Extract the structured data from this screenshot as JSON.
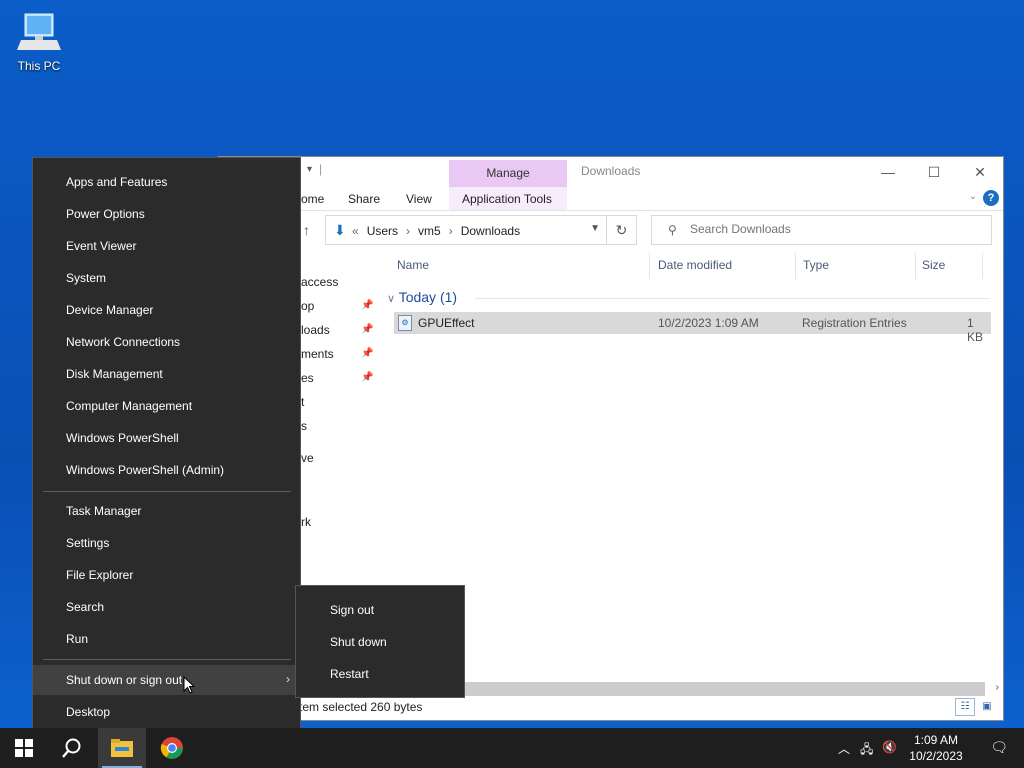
{
  "desktop": {
    "icons": [
      {
        "label": "This PC",
        "icon": "computer-icon"
      }
    ]
  },
  "explorer": {
    "title": "Downloads",
    "manage_tab": "Manage",
    "ribbon_tabs": {
      "home": "ome",
      "share": "Share",
      "view": "View",
      "app_tools": "Application Tools"
    },
    "address": {
      "prefix": "«",
      "crumbs": [
        "Users",
        "vm5",
        "Downloads"
      ]
    },
    "search_placeholder": "Search Downloads",
    "nav_items": [
      "access",
      "op",
      "loads",
      "ments",
      "es",
      "t",
      "s",
      "ve",
      "",
      "rk"
    ],
    "columns": {
      "name": "Name",
      "date": "Date modified",
      "type": "Type",
      "size": "Size"
    },
    "group": "Today (1)",
    "files": [
      {
        "name": "GPUEffect",
        "date": "10/2/2023 1:09 AM",
        "type": "Registration Entries",
        "size": "1 KB"
      }
    ],
    "status": "tem selected  260 bytes"
  },
  "winx_menu": {
    "group1": [
      "Apps and Features",
      "Power Options",
      "Event Viewer",
      "System",
      "Device Manager",
      "Network Connections",
      "Disk Management",
      "Computer Management",
      "Windows PowerShell",
      "Windows PowerShell (Admin)"
    ],
    "group2": [
      "Task Manager",
      "Settings",
      "File Explorer",
      "Search",
      "Run"
    ],
    "shutdown": "Shut down or sign out",
    "desktop": "Desktop"
  },
  "submenu": [
    "Sign out",
    "Shut down",
    "Restart"
  ],
  "taskbar": {
    "clock_time": "1:09 AM",
    "clock_date": "10/2/2023"
  },
  "colors": {
    "accent": "#0b5dc8",
    "menu_bg": "#2b2b2b",
    "manage_tab": "#e9c9f3"
  }
}
